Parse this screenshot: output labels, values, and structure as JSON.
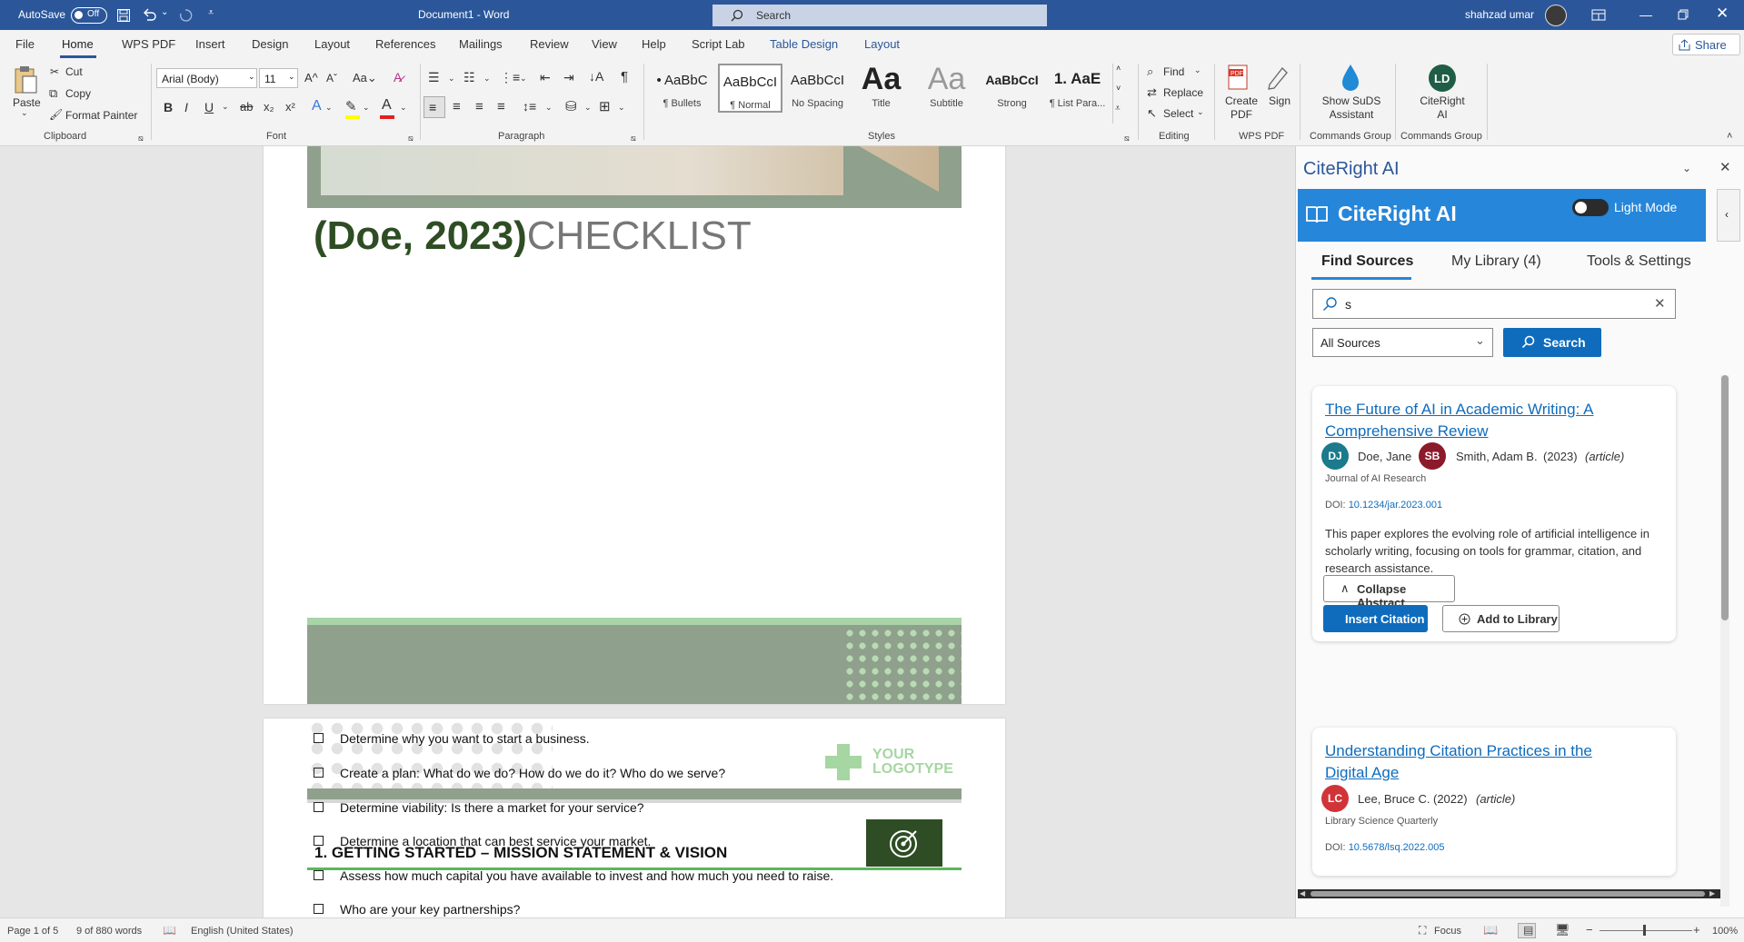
{
  "titlebar": {
    "autosave": "AutoSave",
    "toggle": "Off",
    "doc_title": "Document1  -  Word",
    "search": "Search",
    "user": "shahzad umar"
  },
  "menu": {
    "tabs": [
      "File",
      "Home",
      "WPS PDF",
      "Insert",
      "Design",
      "Layout",
      "References",
      "Mailings",
      "Review",
      "View",
      "Help",
      "Script Lab",
      "Table Design",
      "Layout"
    ],
    "share": "Share"
  },
  "ribbon": {
    "paste": "Paste",
    "cut": "Cut",
    "copy": "Copy",
    "format_painter": "Format Painter",
    "font_name": "Arial (Body)",
    "font_size": "11",
    "styles": [
      {
        "preview": "• AaBbC",
        "name": "¶ Bullets"
      },
      {
        "preview": "AaBbCcI",
        "name": "¶ Normal"
      },
      {
        "preview": "AaBbCcI",
        "name": "No Spacing"
      },
      {
        "preview": "Aa",
        "name": "Title"
      },
      {
        "preview": "Aa",
        "name": "Subtitle"
      },
      {
        "preview": "AaBbCcI",
        "name": "Strong"
      },
      {
        "preview": "1. AaE",
        "name": "¶ List Para..."
      }
    ],
    "find": "Find",
    "replace": "Replace",
    "select": "Select",
    "create_pdf": "Create PDF",
    "sign": "Sign",
    "suds": "Show SuDS Assistant",
    "citeright": "CiteRight AI",
    "groups": {
      "clipboard": "Clipboard",
      "font": "Font",
      "paragraph": "Paragraph",
      "styles": "Styles",
      "editing": "Editing",
      "wps": "WPS PDF",
      "cmd1": "Commands Group",
      "cmd2": "Commands Group"
    }
  },
  "document": {
    "citation": "(Doe, 2023)",
    "heading": "CHECKLIST",
    "logo_line1": "YOUR",
    "logo_line2": "LOGOTYPE",
    "section_title": "1.  GETTING STARTED – MISSION STATEMENT & VISION",
    "checklist": [
      "Determine why you want to start a business.",
      "Create a plan: What do we do? How do we do it? Who do we serve?",
      "Determine viability: Is there a market for your service?",
      "Determine a location that can best service your market.",
      "Assess how much capital you have available to invest and how much you need to raise.",
      "Who are your key partnerships?"
    ]
  },
  "pane": {
    "title": "CiteRight AI",
    "header_name": "CiteRight AI",
    "mode_label": "Light Mode",
    "tabs": [
      "Find Sources",
      "My Library (4)",
      "Tools & Settings"
    ],
    "query": "s",
    "sources": "All Sources",
    "search_btn": "Search",
    "results": [
      {
        "title": "The Future of AI in Academic Writing: A Comprehensive Review",
        "authors": [
          {
            "initials": "DJ",
            "name": "Doe, Jane",
            "color": "#1b7a8c"
          },
          {
            "initials": "SB",
            "name": "Smith, Adam B.",
            "color": "#8b1a2b"
          }
        ],
        "year": "(2023)",
        "type": "(article)",
        "journal": "Journal of AI Research",
        "doi_label": "DOI:",
        "doi": "10.1234/jar.2023.001",
        "abstract": "This paper explores the evolving role of artificial intelligence in scholarly writing, focusing on tools for grammar, citation, and research assistance.",
        "collapse": "Collapse Abstract",
        "insert": "Insert Citation",
        "add": "Add to Library"
      },
      {
        "title": "Understanding Citation Practices in the Digital Age",
        "authors": [
          {
            "initials": "LC",
            "name": "Lee, Bruce C.",
            "color": "#d13438"
          }
        ],
        "year": "(2022)",
        "type": "(article)",
        "journal": "Library Science Quarterly",
        "doi_label": "DOI:",
        "doi": "10.5678/lsq.2022.005"
      }
    ]
  },
  "status": {
    "page": "Page 1 of 5",
    "words": "9 of 880 words",
    "lang": "English (United States)",
    "focus": "Focus",
    "zoom": "100%"
  }
}
